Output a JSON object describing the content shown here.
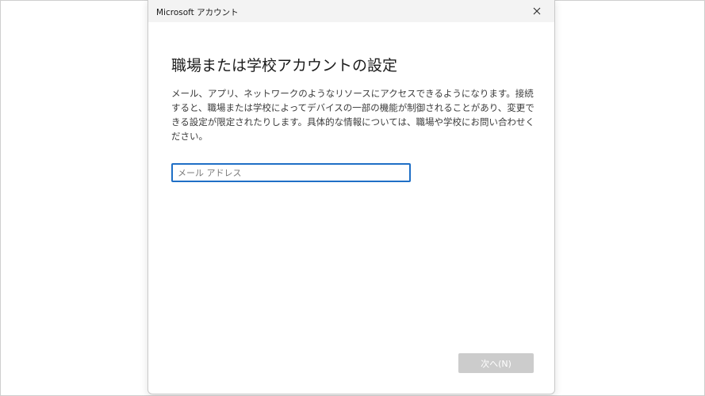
{
  "window": {
    "title": "Microsoft アカウント",
    "close_icon": "close-icon"
  },
  "main": {
    "heading": "職場または学校アカウントの設定",
    "description": "メール、アプリ、ネットワークのようなリソースにアクセスできるようになります。接続すると、職場または学校によってデバイスの一部の機能が制御されることがあり、変更できる設定が限定されたりします。具体的な情報については、職場や学校にお問い合わせください。",
    "email_input": {
      "placeholder": "メール アドレス",
      "value": ""
    },
    "next_button_label": "次へ(N)"
  }
}
